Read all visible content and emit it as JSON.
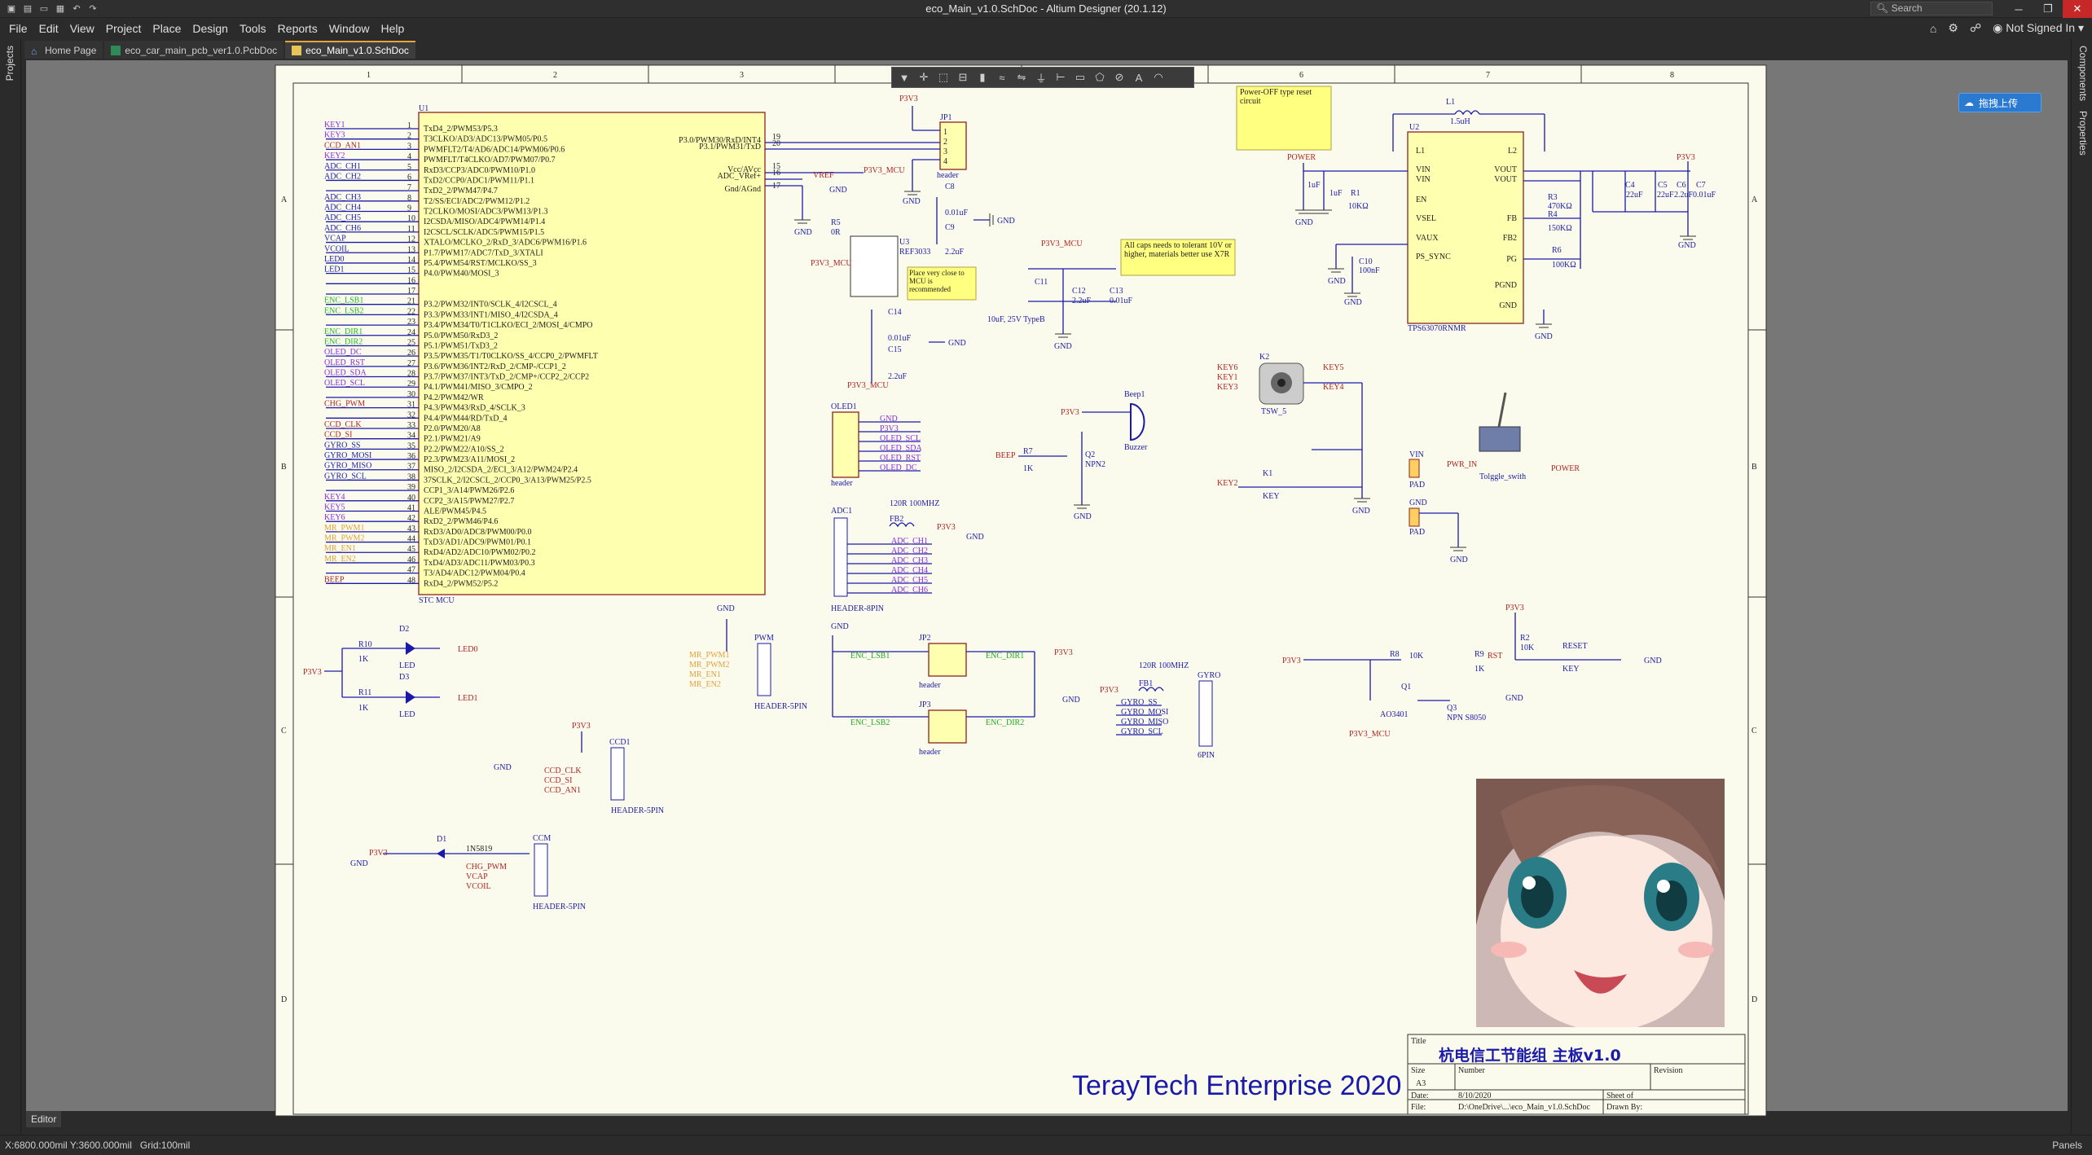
{
  "window": {
    "title": "eco_Main_v1.0.SchDoc - Altium Designer (20.1.12)",
    "search_placeholder": "Search"
  },
  "menu": [
    "File",
    "Edit",
    "View",
    "Project",
    "Place",
    "Design",
    "Tools",
    "Reports",
    "Window",
    "Help"
  ],
  "account": "Not Signed In",
  "tabs": [
    {
      "label": "Home Page",
      "icon": "home-icon",
      "active": false
    },
    {
      "label": "eco_car_main_pcb_ver1.0.PcbDoc",
      "icon": "pcb-doc-icon",
      "active": false
    },
    {
      "label": "eco_Main_v1.0.SchDoc",
      "icon": "sch-doc-icon",
      "active": true
    }
  ],
  "left_panel_tabs": [
    "Projects"
  ],
  "right_panel_tabs": [
    "Components",
    "Properties"
  ],
  "upload_button": "拖拽上传",
  "editor_label": "Editor",
  "status": {
    "coords": "X:6800.000mil Y:3600.000mil",
    "grid": "Grid:100mil",
    "panels": "Panels"
  },
  "sheet": {
    "columns": [
      "1",
      "2",
      "3",
      "4",
      "5",
      "6",
      "7",
      "8"
    ],
    "rows": [
      "A",
      "B",
      "C",
      "D"
    ],
    "company": "TerayTech Enterprise 2020",
    "title_block": {
      "title_label": "Title",
      "title": "杭电信工节能组 主板v1.0",
      "size_label": "Size",
      "size": "A3",
      "number_label": "Number",
      "revision_label": "Revision",
      "date_label": "Date:",
      "date": "8/10/2020",
      "sheet_label": "Sheet   of",
      "file_label": "File:",
      "file": "D:\\OneDrive\\...\\eco_Main_v1.0.SchDoc",
      "drawn_label": "Drawn By:"
    }
  },
  "mcu": {
    "designator": "U1",
    "name": "STC MCU",
    "left_pins": [
      {
        "num": "1",
        "name": "TxD4_2/PWM53/P5.3",
        "net": "KEY1",
        "color": "#8a2be2"
      },
      {
        "num": "2",
        "name": "T3CLKO/AD3/ADC13/PWM05/P0.5",
        "net": "KEY3",
        "color": "#8a2be2"
      },
      {
        "num": "3",
        "name": "PWMFLT2/T4/AD6/ADC14/PWM06/P0.6",
        "net": "CCD_AN1",
        "color": "#b22222"
      },
      {
        "num": "4",
        "name": "PWMFLT/T4CLKO/AD7/PWM07/P0.7",
        "net": "KEY2",
        "color": "#8a2be2"
      },
      {
        "num": "5",
        "name": "RxD3/CCP3/ADC0/PWM10/P1.0",
        "net": "ADC_CH1",
        "color": "#1a1aaa"
      },
      {
        "num": "6",
        "name": "TxD2/CCP0/ADC1/PWM11/P1.1",
        "net": "ADC_CH2",
        "color": "#1a1aaa"
      },
      {
        "num": "7",
        "name": "TxD2_2/PWM47/P4.7",
        "net": "",
        "color": "#1a1aaa"
      },
      {
        "num": "8",
        "name": "T2/SS/ECI/ADC2/PWM12/P1.2",
        "net": "ADC_CH3",
        "color": "#1a1aaa"
      },
      {
        "num": "9",
        "name": "T2CLKO/MOSI/ADC3/PWM13/P1.3",
        "net": "ADC_CH4",
        "color": "#1a1aaa"
      },
      {
        "num": "10",
        "name": "I2CSDA/MISO/ADC4/PWM14/P1.4",
        "net": "ADC_CH5",
        "color": "#1a1aaa"
      },
      {
        "num": "11",
        "name": "I2CSCL/SCLK/ADC5/PWM15/P1.5",
        "net": "ADC_CH6",
        "color": "#1a1aaa"
      },
      {
        "num": "12",
        "name": "XTALO/MCLKO_2/RxD_3/ADC6/PWM16/P1.6",
        "net": "VCAP",
        "color": "#1a1aaa"
      },
      {
        "num": "13",
        "name": "P1.7/PWM17/ADC7/TxD_3/XTALI",
        "net": "VCOIL",
        "color": "#1a1aaa"
      },
      {
        "num": "14",
        "name": "P5.4/PWM54/RST/MCLKO/SS_3",
        "net": "LED0",
        "color": "#1a1aaa"
      },
      {
        "num": "15",
        "name": "P4.0/PWM40/MOSI_3",
        "net": "LED1",
        "color": "#1a1aaa"
      },
      {
        "num": "16",
        "name": "",
        "net": "",
        "color": "#1a1aaa"
      },
      {
        "num": "17",
        "name": "",
        "net": "",
        "color": "#1a1aaa"
      },
      {
        "num": "21",
        "name": "P3.2/PWM32/INT0/SCLK_4/I2CSCL_4",
        "net": "ENC_LSB1",
        "color": "#22bb22"
      },
      {
        "num": "22",
        "name": "P3.3/PWM33/INT1/MISO_4/I2CSDA_4",
        "net": "ENC_LSB2",
        "color": "#22bb22"
      },
      {
        "num": "23",
        "name": "P3.4/PWM34/T0/T1CLKO/ECI_2/MOSI_4/CMPO",
        "net": "",
        "color": "#22bb22"
      },
      {
        "num": "24",
        "name": "P5.0/PWM50/RxD3_2",
        "net": "ENC_DIR1",
        "color": "#22bb22"
      },
      {
        "num": "25",
        "name": "P5.1/PWM51/TxD3_2",
        "net": "ENC_DIR2",
        "color": "#22bb22"
      },
      {
        "num": "26",
        "name": "P3.5/PWM35/T1/T0CLKO/SS_4/CCP0_2/PWMFLT",
        "net": "OLED_DC",
        "color": "#8a2be2"
      },
      {
        "num": "27",
        "name": "P3.6/PWM36/INT2/RxD_2/CMP-/CCP1_2",
        "net": "OLED_RST",
        "color": "#8a2be2"
      },
      {
        "num": "28",
        "name": "P3.7/PWM37/INT3/TxD_2/CMP+/CCP2_2/CCP2",
        "net": "OLED_SDA",
        "color": "#8a2be2"
      },
      {
        "num": "29",
        "name": "P4.1/PWM41/MISO_3/CMPO_2",
        "net": "OLED_SCL",
        "color": "#8a2be2"
      },
      {
        "num": "30",
        "name": "P4.2/PWM42/WR",
        "net": "",
        "color": "#8a2be2"
      },
      {
        "num": "31",
        "name": "P4.3/PWM43/RxD_4/SCLK_3",
        "net": "CHG_PWM",
        "color": "#b22222"
      },
      {
        "num": "32",
        "name": "P4.4/PWM44/RD/TxD_4",
        "net": "",
        "color": "#b22222"
      },
      {
        "num": "33",
        "name": "P2.0/PWM20/A8",
        "net": "CCD_CLK",
        "color": "#b22222"
      },
      {
        "num": "34",
        "name": "P2.1/PWM21/A9",
        "net": "CCD_SI",
        "color": "#b22222"
      },
      {
        "num": "35",
        "name": "P2.2/PWM22/A10/SS_2",
        "net": "GYRO_SS",
        "color": "#1a1aaa"
      },
      {
        "num": "36",
        "name": "P2.3/PWM23/A11/MOSI_2",
        "net": "GYRO_MOSI",
        "color": "#1a1aaa"
      },
      {
        "num": "37",
        "name": "MISO_2/I2CSDA_2/ECI_3/A12/PWM24/P2.4",
        "net": "GYRO_MISO",
        "color": "#1a1aaa"
      },
      {
        "num": "38",
        "name": "37SCLK_2/I2CSCL_2/CCP0_3/A13/PWM25/P2.5",
        "net": "GYRO_SCL",
        "color": "#1a1aaa"
      },
      {
        "num": "39",
        "name": "CCP1_3/A14/PWM26/P2.6",
        "net": "",
        "color": "#1a1aaa"
      },
      {
        "num": "40",
        "name": "CCP2_3/A15/PWM27/P2.7",
        "net": "KEY4",
        "color": "#8a2be2"
      },
      {
        "num": "41",
        "name": "ALE/PWM45/P4.5",
        "net": "KEY5",
        "color": "#8a2be2"
      },
      {
        "num": "42",
        "name": "RxD2_2/PWM46/P4.6",
        "net": "KEY6",
        "color": "#8a2be2"
      },
      {
        "num": "43",
        "name": "RxD3/AD0/ADC8/PWM00/P0.0",
        "net": "MR_PWM1",
        "color": "#e3a03a"
      },
      {
        "num": "44",
        "name": "TxD3/AD1/ADC9/PWM01/P0.1",
        "net": "MR_PWM2",
        "color": "#e3a03a"
      },
      {
        "num": "45",
        "name": "RxD4/AD2/ADC10/PWM02/P0.2",
        "net": "MR_EN1",
        "color": "#e3a03a"
      },
      {
        "num": "46",
        "name": "TxD4/AD3/ADC11/PWM03/P0.3",
        "net": "MR_EN2",
        "color": "#e3a03a"
      },
      {
        "num": "47",
        "name": "T3/AD4/ADC12/PWM04/P0.4",
        "net": "",
        "color": "#1a1aaa"
      },
      {
        "num": "48",
        "name": "RxD4_2/PWM52/P5.2",
        "net": "BEEP",
        "color": "#b22222"
      }
    ],
    "right_pins": [
      {
        "num": "19",
        "name": "P3.0/PWM30/RxD/INT4"
      },
      {
        "num": "20",
        "name": "P3.1/PWM31/TxD"
      },
      {
        "num": "15",
        "name": "Vcc/AVcc"
      },
      {
        "num": "16",
        "name": "ADC_VRef+"
      },
      {
        "num": "17",
        "name": "Gnd/AGnd"
      }
    ]
  },
  "labels": {
    "jp1": "JP1",
    "header": "header",
    "p3v3": "P3V3",
    "p3v3_mcu": "P3V3_MCU",
    "gnd": "GND",
    "vref": "VREF",
    "u3": "U3",
    "ref3033": "REF3033",
    "r5": "R5",
    "r5v": "0R",
    "c8": "C8",
    "c8v": "0.01uF",
    "c9": "C9",
    "c9v": "2.2uF",
    "c14": "C14",
    "c14v": "0.01uF",
    "c15": "C15",
    "c15v": "2.2uF",
    "note_ref": "Place very close to MCU is recommended",
    "note_caps": "All caps needs to tolerant 10V or higher, materials better use X7R",
    "note_power": "Power-OFF type reset circuit",
    "c11": "C11",
    "c12": "C12",
    "c13": "C13",
    "c11v": "10uF, 25V TypeB",
    "c12v": "2.2uF",
    "c13v": "0.01uF",
    "l1": "L1",
    "l1v": "1.5uH",
    "u2": "U2",
    "u2name": "TPS63070RNMR",
    "power": "POWER",
    "r1": "R1",
    "r1v": "10KΩ",
    "r3": "R3",
    "r3v": "470KΩ",
    "r4": "R4",
    "r4v": "150KΩ",
    "r6": "R6",
    "r6v": "100KΩ",
    "c10": "C10",
    "c10v": "100nF",
    "c4": "C4",
    "c5": "C5",
    "c6": "C6",
    "c7": "C7",
    "c4v": "22uF",
    "c5v": "22uF",
    "c6v": "2.2uF",
    "c7v": "0.01uF",
    "c1v": "1uF",
    "c2v": "1uF",
    "u2pins_left": [
      "L1",
      "VIN",
      "VIN",
      "EN",
      "VSEL",
      "VAUX",
      "PS_SYNC"
    ],
    "u2pins_right": [
      "L2",
      "VOUT",
      "VOUT",
      "FB",
      "FB2",
      "PG",
      "PGND",
      "GND"
    ],
    "k2": "K2",
    "tsw": "TSW_5",
    "key6": "KEY6",
    "key1": "KEY1",
    "key3": "KEY3",
    "key5": "KEY5",
    "key4": "KEY4",
    "key2": "KEY2",
    "k1": "K1",
    "key": "KEY",
    "beep1": "Beep1",
    "buzzer": "Buzzer",
    "beep": "BEEP",
    "r7": "R7",
    "r7v": "1K",
    "q2": "Q2",
    "npn2": "NPN2",
    "vin": "VIN",
    "pad": "PAD",
    "pwr_in": "PWR_IN",
    "toggle": "Tolggle_swith",
    "oled1": "OLED1",
    "oled_nets": [
      "GND",
      "P3V3",
      "OLED_SCL",
      "OLED_SDA",
      "OLED_RST",
      "OLED_DC"
    ],
    "adc1": "ADC1",
    "fb2": "FB2",
    "fb2v": "120R 100MHZ",
    "header8": "HEADER-8PIN",
    "adc_nets": [
      "ADC_CH1",
      "ADC_CH2",
      "ADC_CH3",
      "ADC_CH4",
      "ADC_CH5",
      "ADC_CH6"
    ],
    "d2": "D2",
    "d3": "D3",
    "led": "LED",
    "led0": "LED0",
    "led1": "LED1",
    "r10": "R10",
    "r11": "R11",
    "k1v": "1K",
    "pwm": "PWM",
    "header5": "HEADER-5PIN",
    "pwm_nets": [
      "MR_PWM1",
      "MR_PWM2",
      "MR_EN1",
      "MR_EN2"
    ],
    "jp2": "JP2",
    "jp3": "JP3",
    "enc_lsb1": "ENC_LSB1",
    "enc_dir1": "ENC_DIR1",
    "enc_lsb2": "ENC_LSB2",
    "enc_dir2": "ENC_DIR2",
    "fb1": "FB1",
    "fb1v": "120R 100MHZ",
    "gyro": "GYRO",
    "6pin": "6PIN",
    "gyro_nets": [
      "GYRO_SS",
      "GYRO_MOSI",
      "GYRO_MISO",
      "GYRO_SCL"
    ],
    "q1": "Q1",
    "ao3401": "AO3401",
    "r8": "R8",
    "r8v": "10K",
    "r9": "R9",
    "r9v": "1K",
    "q3": "Q3",
    "npn8050": "NPN S8050",
    "r2": "R2",
    "r2v": "10K",
    "rst": "RST",
    "reset": "RESET",
    "ccd1": "CCD1",
    "ccd_nets": [
      "CCD_CLK",
      "CCD_SI",
      "CCD_AN1"
    ],
    "d1": "D1",
    "in5819": "1N5819",
    "ccm": "CCM",
    "ccm_nets": [
      "CHG_PWM",
      "VCAP",
      "VCOIL"
    ]
  }
}
